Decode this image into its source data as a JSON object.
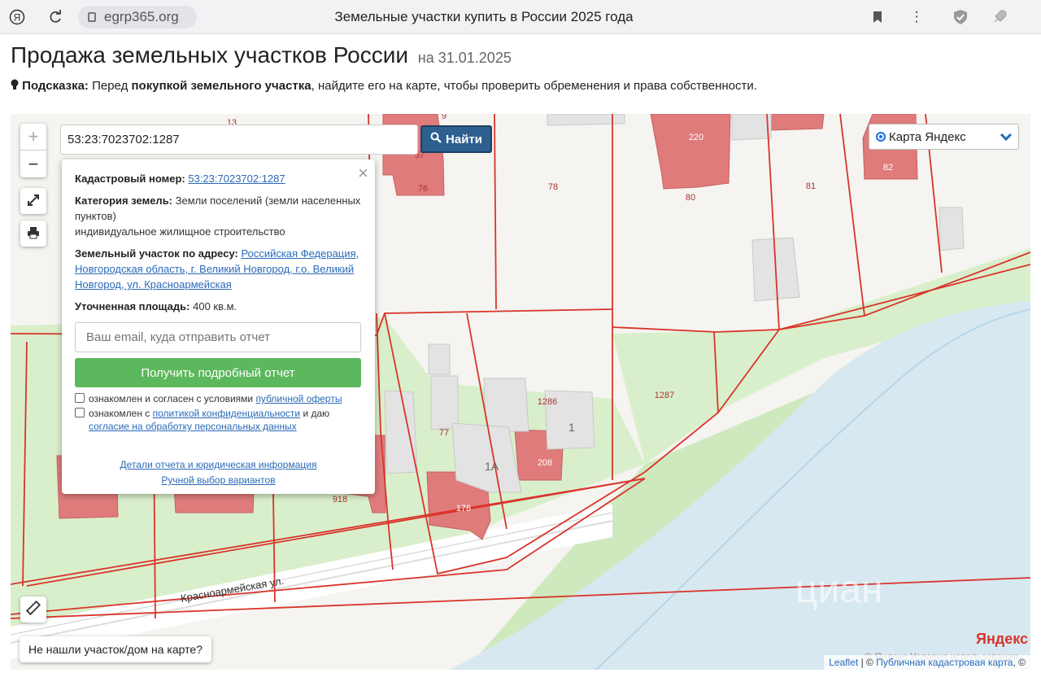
{
  "browser": {
    "url": "egrp365.org",
    "tab_title": "Земельные участки купить в России 2025 года",
    "icons": [
      "yandex-logo-icon",
      "reload-icon",
      "lock-icon",
      "bookmark-icon",
      "menu-dots-icon",
      "shield-icon",
      "rocket-icon"
    ]
  },
  "header": {
    "title": "Продажа земельных участков России",
    "date": "на 31.01.2025",
    "hint_label": "Подсказка:",
    "hint_text_1": "Перед ",
    "hint_bold": "покупкой земельного участка",
    "hint_text_2": ", найдите его на карте, чтобы проверить обременения и права собственности."
  },
  "map": {
    "search_value": "53:23:7023702:1287",
    "search_button": "Найти",
    "layer": "Карта Яндекс",
    "zoom_in": "+",
    "zoom_out": "−",
    "not_found": "Не нашли участок/дом на карте?",
    "street_label": "Красноармейская ул.",
    "yandex_logo": "Яндекс",
    "yandex_terms": "© Яндекс Условия использования",
    "attribution_leaflet": "Leaflet",
    "attribution_sep": " | © ",
    "attribution_pkk": "Публичная кадастровая карта",
    "attribution_end": ", ©",
    "labels": [
      "9",
      "13",
      "220",
      "82",
      "57",
      "76",
      "78",
      "80",
      "81",
      "1286",
      "1287",
      "1",
      "77",
      "1A",
      "208",
      "176",
      "918"
    ],
    "colors": {
      "parcel_line": "#d9342b",
      "building": "#e07070",
      "grass": "#d7efc6",
      "river": "#d8e8f0"
    }
  },
  "popup": {
    "cadastral_label": "Кадастровый номер:",
    "cadastral_value": "53:23:7023702:1287",
    "category_label": "Категория земель:",
    "category_value": "Земли поселений (земли населенных пунктов)",
    "usage_value": "индивидуальное жилищное строительство",
    "address_label": "Земельный участок по адресу:",
    "address_value": "Российская Федерация, Новгородская область, г. Великий Новгород, г.о. Великий Новгород, ул. Красноармейская",
    "area_label": "Уточненная площадь:",
    "area_value": "400 кв.м.",
    "email_placeholder": "Ваш email, куда отправить отчет",
    "report_button": "Получить подробный отчет",
    "check1_text": "ознакомлен и согласен с условиями ",
    "check1_link": "публичной оферты",
    "check2_text": "ознакомлен с ",
    "check2_link": "политикой конфиденциальности",
    "check2_text2": " и даю ",
    "check2_link2": "согласие на обработку персональных данных",
    "details_link": "Детали отчета и юридическая информация",
    "manual_link": "Ручной выбор вариантов",
    "close": "×"
  }
}
